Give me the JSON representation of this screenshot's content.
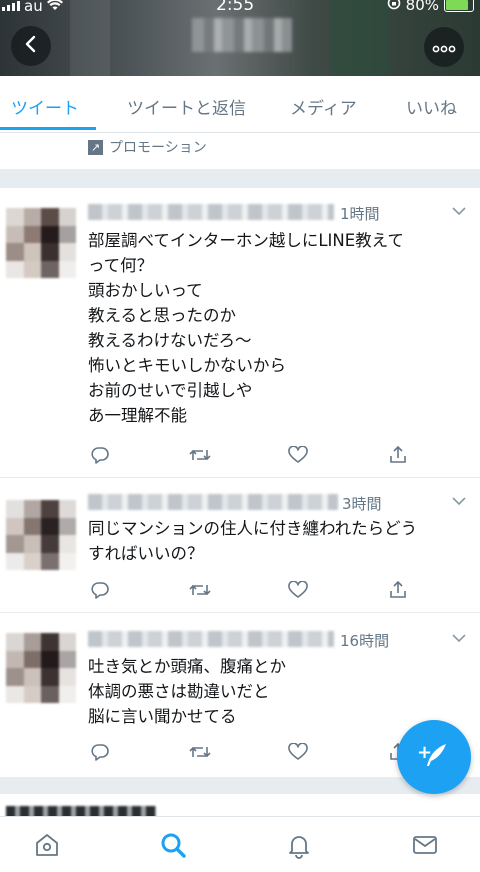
{
  "status_bar": {
    "carrier": "au",
    "time": "2:55",
    "battery": "80%"
  },
  "tabs": [
    {
      "label": "ツイート",
      "active": true
    },
    {
      "label": "ツイートと返信",
      "active": false
    },
    {
      "label": "メディア",
      "active": false
    },
    {
      "label": "いいね",
      "active": false
    }
  ],
  "promo": {
    "label": "プロモーション"
  },
  "tweets": [
    {
      "time": "1時間",
      "text": "部屋調べてインターホン越しにLINE教えて\nって何？\n頭おかしいって\n教えると思ったのか\n教えるわけないだろ～\n怖いとキモいしかないから\nお前のせいで引越しや\nあ一理解不能"
    },
    {
      "time": "3時間",
      "text": "同じマンションの住人に付き纏われたらどう\nすればいいの？"
    },
    {
      "time": "16時間",
      "text": "吐き気とか頭痛、腹痛とか\n体調の悪さは勘違いだと\n脳に言い聞かせてる"
    }
  ],
  "colors": {
    "accent": "#1da1f2",
    "secondary_text": "#657786",
    "divider": "#e6ecf0"
  },
  "icons": {
    "header": [
      "back-icon",
      "more-icon"
    ],
    "tweet_actions": [
      "reply-icon",
      "retweet-icon",
      "like-icon",
      "share-icon"
    ],
    "bottom_nav": [
      "home-icon",
      "search-icon",
      "notifications-icon",
      "messages-icon"
    ],
    "fab": "compose-icon"
  }
}
